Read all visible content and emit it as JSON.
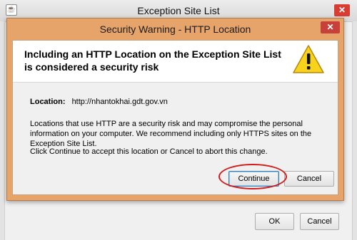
{
  "background_window": {
    "title": "Exception Site List",
    "icon_glyph": "☕",
    "close_glyph": "✕",
    "ok_label": "OK",
    "cancel_label": "Cancel"
  },
  "dialog": {
    "title": "Security Warning - HTTP Location",
    "close_glyph": "✕",
    "headline": "Including an HTTP Location on the Exception Site List is considered a security risk",
    "warning_icon": "warning-triangle-icon",
    "location_label": "Location:",
    "location_value": "http://nhantokhai.gdt.gov.vn",
    "message": "Locations that use HTTP are a security risk and may compromise the personal information on your computer.  We recommend including only HTTPS sites on the Exception Site List.",
    "instruction": "Click Continue to accept this location or Cancel to abort this change.",
    "continue_label": "Continue",
    "cancel_label": "Cancel"
  },
  "colors": {
    "dialog_frame": "#e6a36a",
    "close_button": "#c7403a",
    "annotation_circle": "#d11c1c"
  }
}
